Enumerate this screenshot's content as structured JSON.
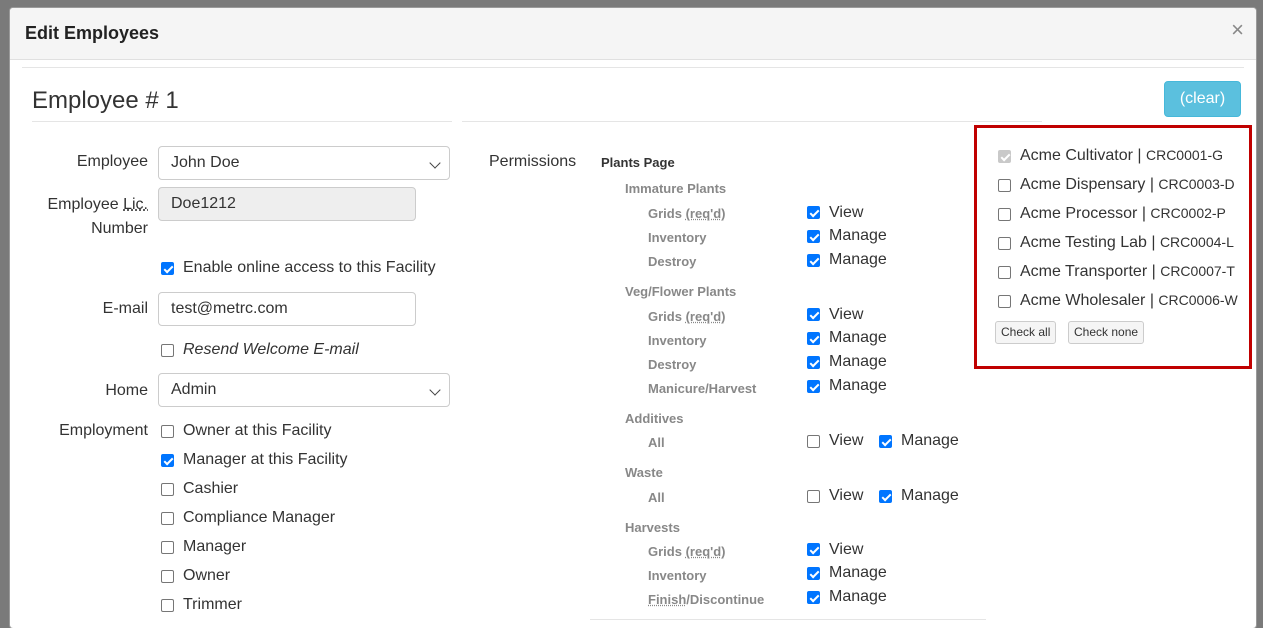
{
  "modal": {
    "title": "Edit Employees",
    "close": "×"
  },
  "employee_title": "Employee # 1",
  "clear_label": "(clear)",
  "form": {
    "employee_label": "Employee",
    "employee_value": "John Doe",
    "lic_label_abbr": "Lic.",
    "lic_label_pre": "Employee ",
    "lic_label_post": "Number",
    "lic_value": "Doe1212",
    "online_access_label": "Enable online access to this Facility",
    "online_access_checked": true,
    "email_label": "E-mail",
    "email_value": "test@metrc.com",
    "resend_label": "Resend Welcome E-mail",
    "resend_checked": false,
    "home_label": "Home",
    "home_value": "Admin",
    "employment_label": "Employment",
    "employment_options": [
      {
        "label": "Owner at this Facility",
        "checked": false
      },
      {
        "label": "Manager at this Facility",
        "checked": true
      },
      {
        "label": "Cashier",
        "checked": false
      },
      {
        "label": "Compliance Manager",
        "checked": false
      },
      {
        "label": "Manager",
        "checked": false
      },
      {
        "label": "Owner",
        "checked": false
      },
      {
        "label": "Trimmer",
        "checked": false
      }
    ]
  },
  "permissions": {
    "label": "Permissions",
    "page": "Plants Page",
    "view": "View",
    "manage": "Manage",
    "groups": [
      {
        "title": "Immature Plants",
        "items": [
          {
            "name": "Grids (req'd)",
            "view": true
          },
          {
            "name": "Inventory",
            "manage": true
          },
          {
            "name": "Destroy",
            "manage": true
          }
        ]
      },
      {
        "title": "Veg/Flower Plants",
        "items": [
          {
            "name": "Grids (req'd)",
            "view": true
          },
          {
            "name": "Inventory",
            "manage": true
          },
          {
            "name": "Destroy",
            "manage": true
          },
          {
            "name": "Manicure/Harvest",
            "manage": true
          }
        ]
      },
      {
        "title": "Additives",
        "items": [
          {
            "name": "All",
            "view": false,
            "manage": true
          }
        ]
      },
      {
        "title": "Waste",
        "items": [
          {
            "name": "All",
            "view": false,
            "manage": true
          }
        ]
      },
      {
        "title": "Harvests",
        "items": [
          {
            "name": "Grids (req'd)",
            "view": true
          },
          {
            "name": "Inventory",
            "manage": true
          },
          {
            "name": "Finish/Discontinue",
            "manage": true
          }
        ]
      }
    ],
    "grids_pre": "Grids ",
    "grids_abbr": "(req'd)",
    "finish_abbr": "Finish",
    "finish_post": "/Discontinue"
  },
  "facilities": {
    "items": [
      {
        "name": "Acme Cultivator",
        "code": "CRC0001-G",
        "checked": true,
        "disabled": true
      },
      {
        "name": "Acme Dispensary",
        "code": "CRC0003-D",
        "checked": false
      },
      {
        "name": "Acme Processor",
        "code": "CRC0002-P",
        "checked": false
      },
      {
        "name": "Acme Testing Lab",
        "code": "CRC0004-L",
        "checked": false
      },
      {
        "name": "Acme Transporter",
        "code": "CRC0007-T",
        "checked": false
      },
      {
        "name": "Acme Wholesaler",
        "code": "CRC0006-W",
        "checked": false
      }
    ],
    "separator": " | ",
    "check_all": "Check all",
    "check_none": "Check none",
    "highlight_color": "#c00000"
  },
  "colors": {
    "accent_checkbox": "#0075ff",
    "clear_button": "#5bc0de"
  }
}
